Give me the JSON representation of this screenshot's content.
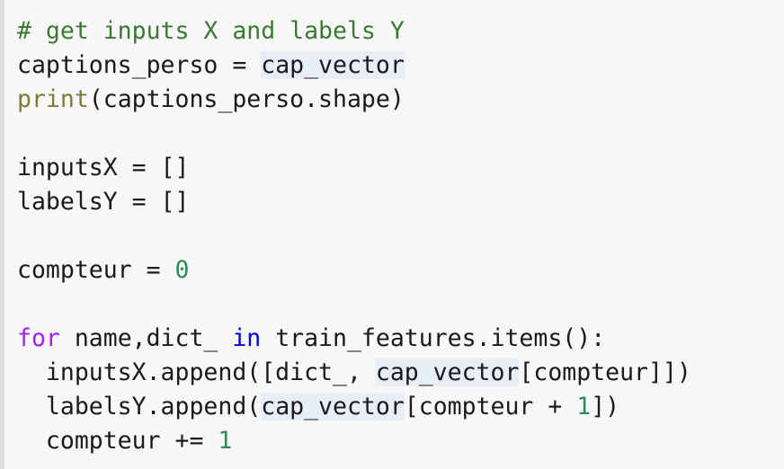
{
  "editor": {
    "language": "python",
    "background_color": "#f7f7f7",
    "gutter_color": "#dedede",
    "highlight_color": "#e8eef8",
    "syntax_colors": {
      "plain": "#1a1a1a",
      "comment": "#3a7a32",
      "builtin": "#7f7a37",
      "keyword": "#a020f0",
      "keyword_operator": "#0000e0",
      "number": "#2e8b57"
    },
    "highlighted_token": "cap_vector",
    "lines": [
      {
        "index": 1,
        "text": "# get inputs X and labels Y",
        "tokens": [
          {
            "t": "# get inputs X and labels Y",
            "c": "comment"
          }
        ]
      },
      {
        "index": 2,
        "text": "captions_perso = cap_vector",
        "tokens": [
          {
            "t": "captions_perso = ",
            "c": "plain"
          },
          {
            "t": "cap_vector",
            "c": "highlight"
          }
        ]
      },
      {
        "index": 3,
        "text": "print(captions_perso.shape)",
        "tokens": [
          {
            "t": "print",
            "c": "builtin"
          },
          {
            "t": "(captions_perso.shape)",
            "c": "plain"
          }
        ]
      },
      {
        "index": 4,
        "text": "",
        "tokens": []
      },
      {
        "index": 5,
        "text": "inputsX = []",
        "tokens": [
          {
            "t": "inputsX = []",
            "c": "plain"
          }
        ]
      },
      {
        "index": 6,
        "text": "labelsY = []",
        "tokens": [
          {
            "t": "labelsY = []",
            "c": "plain"
          }
        ]
      },
      {
        "index": 7,
        "text": "",
        "tokens": []
      },
      {
        "index": 8,
        "text": "compteur = 0",
        "tokens": [
          {
            "t": "compteur = ",
            "c": "plain"
          },
          {
            "t": "0",
            "c": "number"
          }
        ]
      },
      {
        "index": 9,
        "text": "",
        "tokens": []
      },
      {
        "index": 10,
        "text": "for name,dict_ in train_features.items():",
        "tokens": [
          {
            "t": "for",
            "c": "keyword"
          },
          {
            "t": " name,dict_ ",
            "c": "plain"
          },
          {
            "t": "in",
            "c": "keyword_operator"
          },
          {
            "t": " train_features.items():",
            "c": "plain"
          }
        ]
      },
      {
        "index": 11,
        "text": "  inputsX.append([dict_, cap_vector[compteur]])",
        "tokens": [
          {
            "t": "  inputsX.append([dict_, ",
            "c": "plain"
          },
          {
            "t": "cap_vector",
            "c": "highlight"
          },
          {
            "t": "[compteur]])",
            "c": "plain"
          }
        ]
      },
      {
        "index": 12,
        "text": "  labelsY.append(cap_vector[compteur + 1])",
        "tokens": [
          {
            "t": "  labelsY.append(",
            "c": "plain"
          },
          {
            "t": "cap_vector",
            "c": "highlight"
          },
          {
            "t": "[compteur + ",
            "c": "plain"
          },
          {
            "t": "1",
            "c": "number"
          },
          {
            "t": "])",
            "c": "plain"
          }
        ]
      },
      {
        "index": 13,
        "text": "  compteur += 1",
        "tokens": [
          {
            "t": "  compteur += ",
            "c": "plain"
          },
          {
            "t": "1",
            "c": "number"
          }
        ]
      }
    ]
  }
}
